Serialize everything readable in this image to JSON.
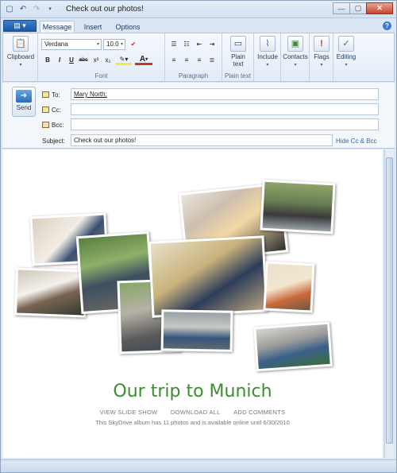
{
  "window": {
    "title": "Check out our photos!"
  },
  "tabs": [
    "Message",
    "Insert",
    "Options"
  ],
  "ribbon": {
    "clipboard": {
      "label": "Clipboard",
      "group_label": ""
    },
    "font": {
      "family": "Verdana",
      "size": "10.0",
      "group_label": "Font"
    },
    "format_buttons": [
      "B",
      "I",
      "U",
      "abc",
      "x²",
      "x₂"
    ],
    "paragraph": {
      "group_label": "Paragraph"
    },
    "plain_text": {
      "label_line1": "Plain",
      "label_line2": "text",
      "group_label": "Plain text"
    },
    "include": {
      "label": "Include"
    },
    "contacts": {
      "label": "Contacts"
    },
    "flags": {
      "label": "Flags"
    },
    "editing": {
      "label": "Editing"
    }
  },
  "compose": {
    "send_label": "Send",
    "to_label": "To:",
    "cc_label": "Cc:",
    "bcc_label": "Bcc:",
    "subject_label": "Subject:",
    "to_value": "Mary North;",
    "cc_value": "",
    "bcc_value": "",
    "subject_value": "Check out our photos!",
    "hide_cc_bcc": "Hide Cc & Bcc"
  },
  "album": {
    "title": "Our trip to Munich",
    "links": [
      "VIEW SLIDE SHOW",
      "DOWNLOAD ALL",
      "ADD COMMENTS"
    ],
    "note": "This SkyDrive album has 11 photos and is available online until 6/30/2010"
  },
  "colors": {
    "album_title": "#3b8e2f",
    "link": "#2e6bb4",
    "file_button": "#1d58a8"
  }
}
